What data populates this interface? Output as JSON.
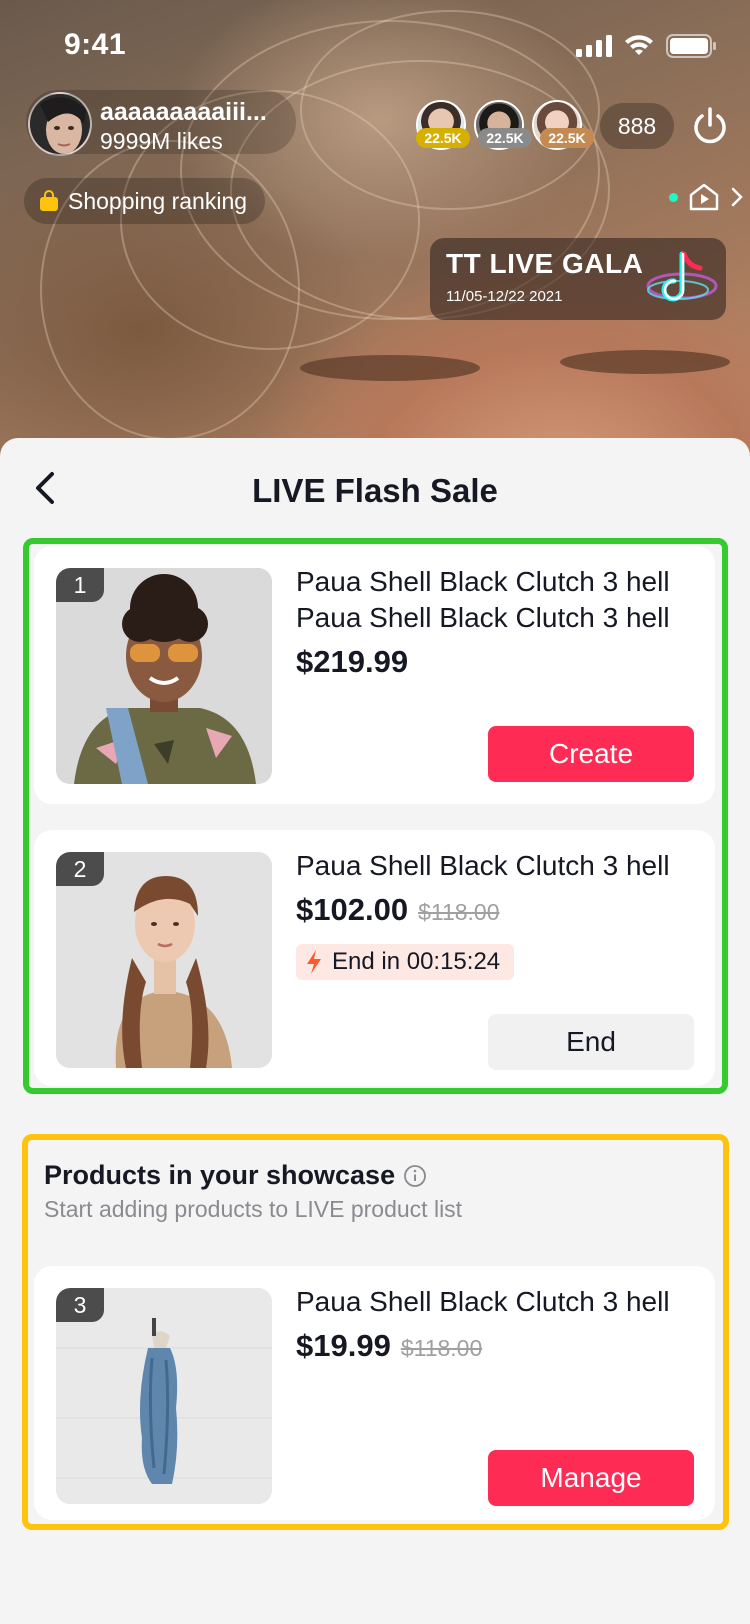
{
  "status_bar": {
    "time": "9:41"
  },
  "live": {
    "host": {
      "name": "aaaaaaaaaiii...",
      "likes": "9999M likes"
    },
    "viewers": [
      {
        "badge": "22.5K",
        "badge_color": "#d6b000"
      },
      {
        "badge": "22.5K",
        "badge_color": "#8a8a8a"
      },
      {
        "badge": "22.5K",
        "badge_color": "#c58a52"
      }
    ],
    "viewer_count": "888",
    "shopping_ranking": "Shopping ranking",
    "event": {
      "title": "TT LIVE GALA",
      "dates": "11/05-12/22 2021"
    }
  },
  "sheet": {
    "title": "LIVE Flash Sale",
    "flash_items": [
      {
        "rank": "1",
        "title": "Paua Shell Black Clutch 3 hell Paua Shell Black Clutch 3 hell",
        "price": "$219.99",
        "button": "Create"
      },
      {
        "rank": "2",
        "title": "Paua Shell Black Clutch 3 hell",
        "price": "$102.00",
        "original_price": "$118.00",
        "countdown": "End in 00:15:24",
        "button": "End"
      }
    ],
    "showcase": {
      "title": "Products in your showcase",
      "subtitle": "Start adding products to LIVE product list",
      "items": [
        {
          "rank": "3",
          "title": "Paua Shell Black Clutch 3 hell",
          "price": "$19.99",
          "original_price": "$118.00",
          "button": "Manage"
        }
      ]
    }
  },
  "colors": {
    "accent": "#fe2c55",
    "flash_border": "#34cb2e",
    "showcase_border": "#ffc20d"
  }
}
